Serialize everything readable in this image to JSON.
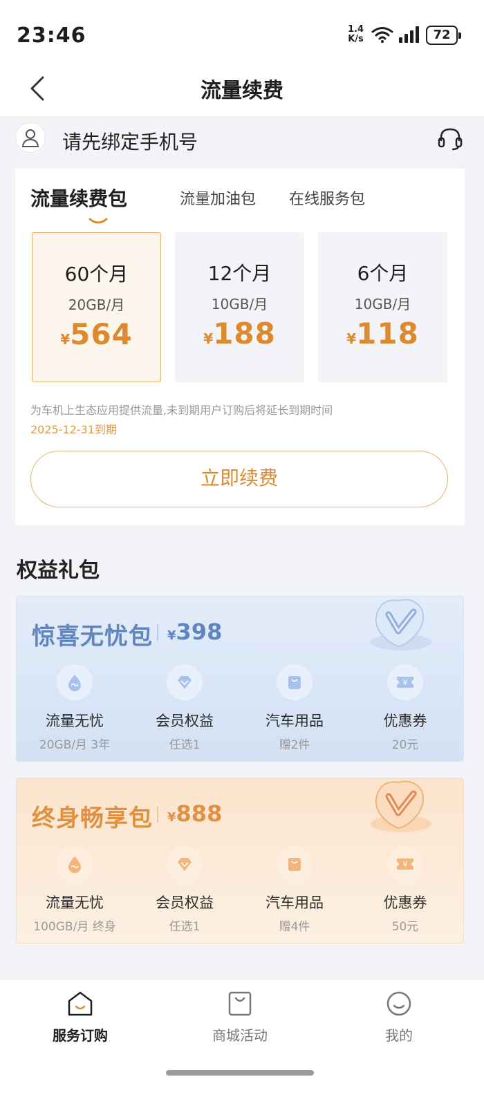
{
  "status": {
    "time": "23:46",
    "net_speed_value": "1.4",
    "net_speed_unit": "K/s",
    "battery": "72"
  },
  "header": {
    "title": "流量续费"
  },
  "account": {
    "prompt": "请先绑定手机号"
  },
  "tabs": [
    {
      "label": "流量续费包",
      "active": true
    },
    {
      "label": "流量加油包",
      "active": false
    },
    {
      "label": "在线服务包",
      "active": false
    }
  ],
  "plans": [
    {
      "duration": "60个月",
      "quota": "20GB/月",
      "currency": "¥",
      "price": "564",
      "selected": true
    },
    {
      "duration": "12个月",
      "quota": "10GB/月",
      "currency": "¥",
      "price": "188",
      "selected": false
    },
    {
      "duration": "6个月",
      "quota": "10GB/月",
      "currency": "¥",
      "price": "118",
      "selected": false
    }
  ],
  "note": "为车机上生态应用提供流量,未到期用户订购后将延长到期时间",
  "expire": "2025-12-31到期",
  "renew_button": "立即续费",
  "gift_section": {
    "title": "权益礼包"
  },
  "gifts": [
    {
      "name": "惊喜无忧包",
      "currency": "¥",
      "price": "398",
      "accent": "#5f86bf",
      "benefits": [
        {
          "title": "流量无忧",
          "sub": "20GB/月 3年",
          "icon": "data-drop-icon"
        },
        {
          "title": "会员权益",
          "sub": "任选1",
          "icon": "diamond-icon"
        },
        {
          "title": "汽车用品",
          "sub": "赠2件",
          "icon": "shopping-bag-icon"
        },
        {
          "title": "优惠券",
          "sub": "20元",
          "icon": "coupon-icon"
        }
      ]
    },
    {
      "name": "终身畅享包",
      "currency": "¥",
      "price": "888",
      "accent": "#e09040",
      "benefits": [
        {
          "title": "流量无忧",
          "sub": "100GB/月 终身",
          "icon": "data-drop-icon"
        },
        {
          "title": "会员权益",
          "sub": "任选1",
          "icon": "diamond-icon"
        },
        {
          "title": "汽车用品",
          "sub": "赠4件",
          "icon": "shopping-bag-icon"
        },
        {
          "title": "优惠券",
          "sub": "50元",
          "icon": "coupon-icon"
        }
      ]
    }
  ],
  "bottom_nav": [
    {
      "label": "服务订购",
      "icon": "home-icon",
      "active": true
    },
    {
      "label": "商城活动",
      "icon": "shopping-bag-icon",
      "active": false
    },
    {
      "label": "我的",
      "icon": "smile-icon",
      "active": false
    }
  ],
  "colors": {
    "accent_gold": "#dd8a2e",
    "blue_package": "#5f86bf",
    "orange_package": "#e09040"
  }
}
